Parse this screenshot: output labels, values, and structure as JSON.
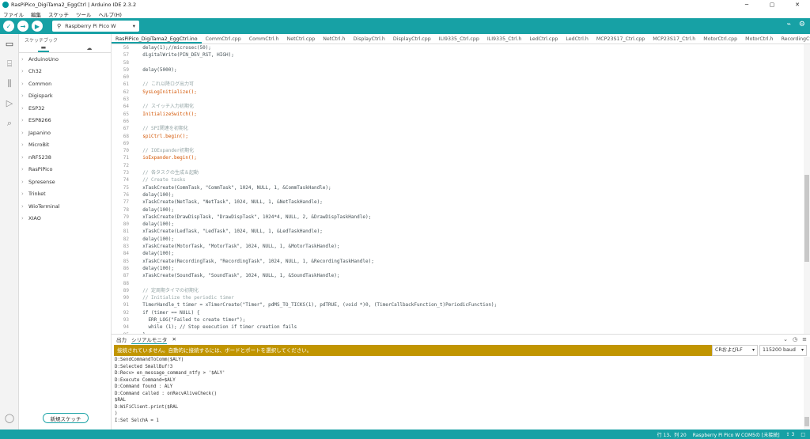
{
  "window": {
    "title": "RasPiPico_DigiTama2_EggCtrl | Arduino IDE 2.3.2",
    "minimize": "─",
    "maximize": "▢",
    "close": "✕"
  },
  "menu": [
    "ファイル",
    "編集",
    "スケッチ",
    "ツール",
    "ヘルプ(H)"
  ],
  "toolbar": {
    "board": "Raspberry Pi Pico W",
    "verify_icon": "✓",
    "upload_icon": "→",
    "debug_icon": "▶"
  },
  "sidebar": {
    "title": "スケッチブック",
    "items": [
      "ArduinoUno",
      "Ch32",
      "Common",
      "Digispark",
      "ESP32",
      "ESP8266",
      "Japanino",
      "MicroBit",
      "nRF5238",
      "RasPiPico",
      "Spresense",
      "Trinket",
      "WioTerminal",
      "XIAO"
    ],
    "new_sketch": "新規スケッチ"
  },
  "tabs": [
    "RasPiPico_DigiTama2_EggCtrl.ino",
    "CommCtrl.cpp",
    "CommCtrl.h",
    "NetCtrl.cpp",
    "NetCtrl.h",
    "DisplayCtrl.h",
    "DisplayCtrl.cpp",
    "ILI9335_Ctrl.cpp",
    "ILI9335_Ctrl.h",
    "LedCtrl.cpp",
    "LedCtrl.h",
    "MCP23S17_Ctrl.cpp",
    "MCP23S17_Ctrl.h",
    "MotorCtrl.cpp",
    "MotorCtrl.h",
    "RecordingCtrl.cpp",
    "Recor"
  ],
  "code_lines": [
    {
      "n": "56",
      "t": "  delay(1);//microsec(50);",
      "c": "code"
    },
    {
      "n": "57",
      "t": "  digitalWrite(PIN_DEV_RST, HIGH);",
      "c": "code"
    },
    {
      "n": "58",
      "t": "",
      "c": "code"
    },
    {
      "n": "59",
      "t": "  delay(5000);",
      "c": "code"
    },
    {
      "n": "60",
      "t": "",
      "c": "code"
    },
    {
      "n": "61",
      "t": "  // これ以降ログ出力可",
      "c": "cm"
    },
    {
      "n": "62",
      "t": "  SysLogInitialize();",
      "c": "fn"
    },
    {
      "n": "63",
      "t": "",
      "c": "code"
    },
    {
      "n": "64",
      "t": "  // スイッチ入力初期化",
      "c": "cm"
    },
    {
      "n": "65",
      "t": "  InitializeSwitch();",
      "c": "fn"
    },
    {
      "n": "66",
      "t": "",
      "c": "code"
    },
    {
      "n": "67",
      "t": "  // SPI関連を初期化",
      "c": "cm"
    },
    {
      "n": "68",
      "t": "  spiCtrl.begin();",
      "c": "fn"
    },
    {
      "n": "69",
      "t": "",
      "c": "code"
    },
    {
      "n": "70",
      "t": "  // IOExpander初期化",
      "c": "cm"
    },
    {
      "n": "71",
      "t": "  ioExpander.begin();",
      "c": "fn"
    },
    {
      "n": "72",
      "t": "",
      "c": "code"
    },
    {
      "n": "73",
      "t": "  // 各タスクの生成＆起動",
      "c": "cm"
    },
    {
      "n": "74",
      "t": "  // Create tasks",
      "c": "cm"
    },
    {
      "n": "75",
      "t": "  xTaskCreate(CommTask, \"CommTask\", 1024, NULL, 1, &CommTaskHandle);",
      "c": "code"
    },
    {
      "n": "76",
      "t": "  delay(100);",
      "c": "code"
    },
    {
      "n": "77",
      "t": "  xTaskCreate(NetTask, \"NetTask\", 1024, NULL, 1, &NetTaskHandle);",
      "c": "code"
    },
    {
      "n": "78",
      "t": "  delay(100);",
      "c": "code"
    },
    {
      "n": "79",
      "t": "  xTaskCreate(DrawDispTask, \"DrawDispTask\", 1024*4, NULL, 2, &DrawDispTaskHandle);",
      "c": "code"
    },
    {
      "n": "80",
      "t": "  delay(100);",
      "c": "code"
    },
    {
      "n": "81",
      "t": "  xTaskCreate(LedTask, \"LedTask\", 1024, NULL, 1, &LedTaskHandle);",
      "c": "code"
    },
    {
      "n": "82",
      "t": "  delay(100);",
      "c": "code"
    },
    {
      "n": "83",
      "t": "  xTaskCreate(MotorTask, \"MotorTask\", 1024, NULL, 1, &MotorTaskHandle);",
      "c": "code"
    },
    {
      "n": "84",
      "t": "  delay(100);",
      "c": "code"
    },
    {
      "n": "85",
      "t": "  xTaskCreate(RecordingTask, \"RecordingTask\", 1024, NULL, 1, &RecordingTaskHandle);",
      "c": "code"
    },
    {
      "n": "86",
      "t": "  delay(100);",
      "c": "code"
    },
    {
      "n": "87",
      "t": "  xTaskCreate(SoundTask, \"SoundTask\", 1024, NULL, 1, &SoundTaskHandle);",
      "c": "code"
    },
    {
      "n": "88",
      "t": "",
      "c": "code"
    },
    {
      "n": "89",
      "t": "  // 定周期タイマの初期化",
      "c": "cm"
    },
    {
      "n": "90",
      "t": "  // Initialize the periodic timer",
      "c": "cm"
    },
    {
      "n": "91",
      "t": "  TimerHandle_t timer = xTimerCreate(\"Timer\", pdMS_TO_TICKS(1), pdTRUE, (void *)0, (TimerCallbackFunction_t)PeriodicFunction);",
      "c": "code"
    },
    {
      "n": "92",
      "t": "  if (timer == NULL) {",
      "c": "code"
    },
    {
      "n": "93",
      "t": "    ERR_LOG(\"Failed to create timer\");",
      "c": "code"
    },
    {
      "n": "94",
      "t": "    while (1); // Stop execution if timer creation fails",
      "c": "code"
    },
    {
      "n": "95",
      "t": "  }",
      "c": "code"
    }
  ],
  "output": {
    "tab_output": "出力",
    "tab_serial": "シリアルモニタ",
    "close": "✕",
    "message": "接続されていません。自動的に接続するには、ボードとポートを選択してください。",
    "line_ending": "CRおよびLF",
    "baud": "115200 baud"
  },
  "serial_lines": [
    "D:SendCommandToComm($ALY)",
    "D:Selected SmallBuf!3",
    "D:Recv> en_message_command_ntfy > '$ALY'",
    "D:Execute Command=$ALY",
    "D:Command found : ALY",
    "D:Command called : onRecvAliveCheck()",
    "$RAL",
    "D:WiFiClient.print($RAL",
    ")",
    "I:Set SelchA = 1"
  ],
  "status": {
    "cursor": "行 13、列 20",
    "board_port": "Raspberry Pi Pico W COM5の [未接続]",
    "notifications": "⇪ 3",
    "layout": "□"
  }
}
